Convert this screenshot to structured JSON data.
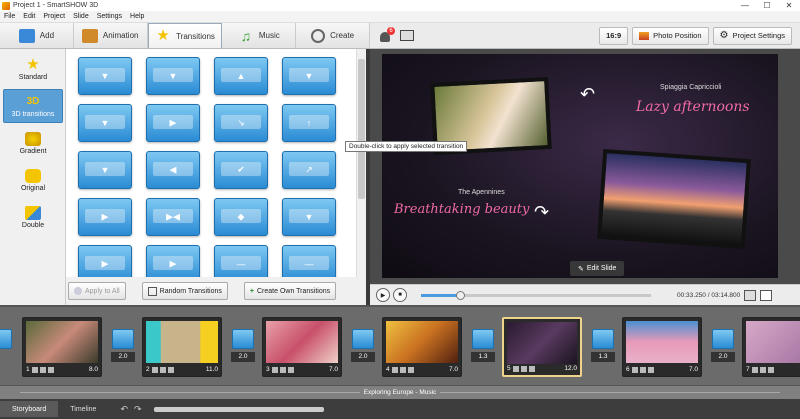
{
  "window": {
    "title": "Project 1 - SmartSHOW 3D",
    "controls": [
      "—",
      "☐",
      "✕"
    ]
  },
  "menu": [
    "File",
    "Edit",
    "Project",
    "Slide",
    "Settings",
    "Help"
  ],
  "top_tabs": [
    {
      "label": "Add",
      "icon": "add-photo-icon",
      "color": "#3a88d8"
    },
    {
      "label": "Animation",
      "icon": "animation-icon",
      "color": "#d08a2a"
    },
    {
      "label": "Transitions",
      "icon": "transitions-star-icon",
      "color": "#f5c400",
      "active": true
    },
    {
      "label": "Music",
      "icon": "music-note-icon",
      "color": "#3aa83a"
    },
    {
      "label": "Create",
      "icon": "film-reel-icon",
      "color": "#666666"
    }
  ],
  "right_toolbar": {
    "notification_count": "6",
    "aspect": "16:9",
    "photo_position": "Photo Position",
    "project_settings": "Project Settings"
  },
  "categories": [
    {
      "label": "Standard",
      "icon": "star-icon",
      "active": false
    },
    {
      "label": "3D transitions",
      "icon": "3d-icon",
      "active": true
    },
    {
      "label": "Gradient",
      "icon": "gradient-icon",
      "active": false
    },
    {
      "label": "Original",
      "icon": "puzzle-icon",
      "active": false
    },
    {
      "label": "Double",
      "icon": "double-icon",
      "active": false
    }
  ],
  "transition_grid_arrows": [
    "▼",
    "▼",
    "▲",
    "▼",
    "▼",
    "▶",
    "↘",
    "↑",
    "▼",
    "◀",
    "✔",
    "↗",
    "▶",
    "▶◀",
    "◆",
    "▼",
    "▶",
    "▶",
    "—",
    "—"
  ],
  "tooltip": "Double-click to apply selected transition",
  "grid_buttons": {
    "apply_all": "Apply to All",
    "random": "Random Transitions",
    "create_own": "Create Own Transitions"
  },
  "preview": {
    "subtitle_right": "Spiaggia Capriccioli",
    "script_right": "Lazy afternoons",
    "subtitle_left": "The Apennines",
    "script_left": "Breathtaking beauty",
    "edit_slide": "Edit Slide"
  },
  "playback": {
    "time": "00:33.250 / 03:14.800",
    "progress_fraction": 0.17
  },
  "slides": [
    {
      "num": "1",
      "duration": "8.0",
      "thumb": "linear-gradient(135deg,#5a6a3a,#c88a7a,#3a3a2a)",
      "active": false
    },
    {
      "num": "2",
      "duration": "11.0",
      "thumb": "linear-gradient(90deg,#3ac8c8 0%,#3ac8c8 20%,#c8b48a 21%,#c8b48a 75%,#f5d020 76%)",
      "active": false
    },
    {
      "num": "3",
      "duration": "7.0",
      "thumb": "linear-gradient(135deg,#e8a0a8,#c8506a,#f0d0c8)",
      "active": false
    },
    {
      "num": "4",
      "duration": "7.0",
      "thumb": "linear-gradient(135deg,#f0c040,#c87020,#502010)",
      "active": false
    },
    {
      "num": "5",
      "duration": "12.0",
      "thumb": "linear-gradient(135deg,#2a1a30,#5a3a60,#1a1420)",
      "active": true
    },
    {
      "num": "6",
      "duration": "7.0",
      "thumb": "linear-gradient(#4a90d0,#e89ab8,#e8b0c8)",
      "active": false
    },
    {
      "num": "7",
      "duration": "",
      "thumb": "linear-gradient(135deg,#d8a8c8,#a070a0)",
      "active": false
    }
  ],
  "transitions": [
    {
      "duration": "2.0"
    },
    {
      "duration": "2.0"
    },
    {
      "duration": "2.0"
    },
    {
      "duration": "1.3"
    },
    {
      "duration": "1.3"
    },
    {
      "duration": "2.0"
    },
    {
      "duration": "2.0"
    }
  ],
  "music_track": "Exploring Europe - Music",
  "bottom_tabs": [
    {
      "label": "Storyboard",
      "active": true
    },
    {
      "label": "Timeline",
      "active": false
    }
  ]
}
